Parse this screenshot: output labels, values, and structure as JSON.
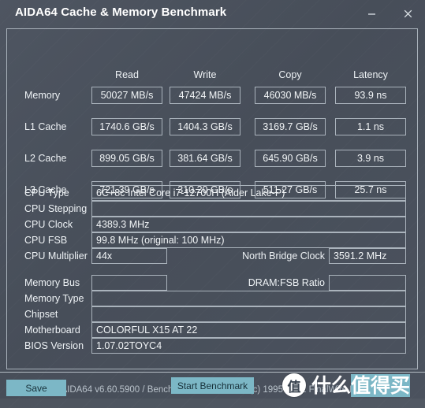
{
  "window": {
    "title": "AIDA64 Cache & Memory Benchmark",
    "minimize_label": "Minimize",
    "close_label": "Close"
  },
  "benchmark": {
    "columns": [
      "Read",
      "Write",
      "Copy",
      "Latency"
    ],
    "rows": [
      {
        "label": "Memory",
        "read": "50027 MB/s",
        "write": "47424 MB/s",
        "copy": "46030 MB/s",
        "latency": "93.9 ns"
      },
      {
        "label": "L1 Cache",
        "read": "1740.6 GB/s",
        "write": "1404.3 GB/s",
        "copy": "3169.7 GB/s",
        "latency": "1.1 ns"
      },
      {
        "label": "L2 Cache",
        "read": "899.05 GB/s",
        "write": "381.64 GB/s",
        "copy": "645.90 GB/s",
        "latency": "3.9 ns"
      },
      {
        "label": "L3 Cache",
        "read": "721.39 GB/s",
        "write": "310.20 GB/s",
        "copy": "511.27 GB/s",
        "latency": "25.7 ns"
      }
    ]
  },
  "cpu_info": {
    "cpu_type_label": "CPU Type",
    "cpu_type_value": "6C+8c Intel Core i7-12700H  (Alder Lake-P)",
    "cpu_stepping_label": "CPU Stepping",
    "cpu_stepping_value": "",
    "cpu_clock_label": "CPU Clock",
    "cpu_clock_value": "4389.3 MHz",
    "cpu_fsb_label": "CPU FSB",
    "cpu_fsb_value": "99.8 MHz  (original: 100 MHz)",
    "cpu_multiplier_label": "CPU Multiplier",
    "cpu_multiplier_value": "44x",
    "north_bridge_clock_label": "North Bridge Clock",
    "north_bridge_clock_value": "3591.2 MHz"
  },
  "system_info": {
    "memory_bus_label": "Memory Bus",
    "memory_bus_value": "",
    "dram_fsb_ratio_label": "DRAM:FSB Ratio",
    "dram_fsb_ratio_value": "",
    "memory_type_label": "Memory Type",
    "memory_type_value": "",
    "chipset_label": "Chipset",
    "chipset_value": "",
    "motherboard_label": "Motherboard",
    "motherboard_value": "COLORFUL X15 AT 22",
    "bios_version_label": "BIOS Version",
    "bios_version_value": "1.07.02TOYC4"
  },
  "footer": {
    "version_text": "AIDA64 v6.60.5900 / BenchDLL 4.5.865.8-x64  (c) 1995-2021 FinalWire Ltd.",
    "save_button": "Save",
    "start_benchmark_button": "Start Benchmark"
  },
  "watermark": {
    "badge": "值",
    "text_plain": "什么",
    "text_highlight": "值得买"
  },
  "colors": {
    "window_background": "#4a515d",
    "panel_border": "#a9b2bb",
    "accent_button": "#7cb7c6",
    "text_primary": "#eef2f5",
    "text_muted": "#b9c2ca"
  }
}
